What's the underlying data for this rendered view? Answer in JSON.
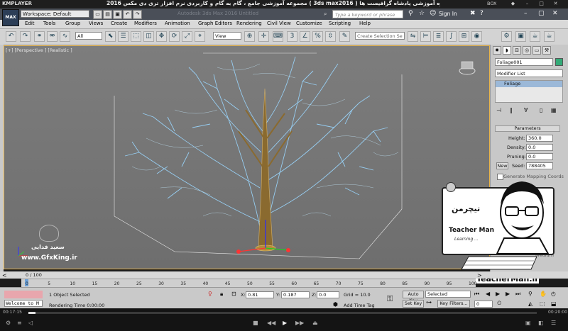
{
  "player": {
    "logo": "KMPLAYER",
    "title": "مجموعه آموزشی جامع ، گام به گام و کاربردی نرم افزار تری دی مکس 2016 ( 3ds max2016 )  مدرس : سعید فدایی ( تیچرمن ) گروه آموزشی پادشاه گرافیست ها",
    "box_label": "BOX",
    "time_elapsed": "00:17:15",
    "time_total": "00:20:00",
    "progress": 0.014
  },
  "max": {
    "logo": "MAX",
    "workspace": "Workspace: Default",
    "doc_title": "Autodesk 3ds Max 2016    Untitled",
    "search_placeholder": "Type a keyword or phrase",
    "signin": "Sign In"
  },
  "menus": [
    "Edit",
    "Tools",
    "Group",
    "Views",
    "Create",
    "Modifiers",
    "Animation",
    "Graph Editors",
    "Rendering",
    "Civil View",
    "Customize",
    "Scripting",
    "Help"
  ],
  "toolbar": {
    "filter": "All",
    "coord": "View",
    "selection_set": "Create Selection Se"
  },
  "viewport": {
    "label": "[+] [Perspective ] [Realistic ]"
  },
  "command_panel": {
    "object_name": "Foliage001",
    "modifier_list": "Modifier List",
    "stack_item": "Foliage",
    "rollout": "Parameters",
    "params": [
      {
        "label": "Height:",
        "value": "360.0"
      },
      {
        "label": "Density:",
        "value": "0.0"
      },
      {
        "label": "Pruning:",
        "value": "0.0"
      }
    ],
    "new_label": "New",
    "seed_label": "Seed:",
    "seed_value": "788405",
    "mapping_label": "Generate Mapping Coords",
    "medium_label": "Medium"
  },
  "watermark": {
    "brand_fa": "سعید فدایی",
    "site": "www.GfxKing.ir",
    "teacherman_fa": "تیچرمن",
    "teacherman_en": "Teacher Man",
    "tagline": "Learning ... ",
    "url": "www.TeacherMan.ir"
  },
  "timeline": {
    "frame": "0 / 100",
    "ticks": [
      "0",
      "5",
      "10",
      "15",
      "20",
      "25",
      "30",
      "35",
      "40",
      "45",
      "50",
      "55",
      "60",
      "65",
      "70",
      "75",
      "80",
      "85",
      "90",
      "95",
      "100"
    ]
  },
  "status": {
    "welcome": "Welcome to M",
    "selected": "1 Object Selected",
    "rendering": "Rendering Time  0:00:00",
    "x_label": "X:",
    "x_value": "0.81",
    "y_label": "Y:",
    "y_value": "0.187",
    "z_label": "Z:",
    "z_value": "0.0",
    "grid": "Grid = 10.0",
    "add_time_tag": "Add Time Tag",
    "auto_key": "Auto Key",
    "set_key": "Set Key",
    "selected_dd": "Selected",
    "key_filters": "Key Filters...",
    "frame_field": "0"
  }
}
